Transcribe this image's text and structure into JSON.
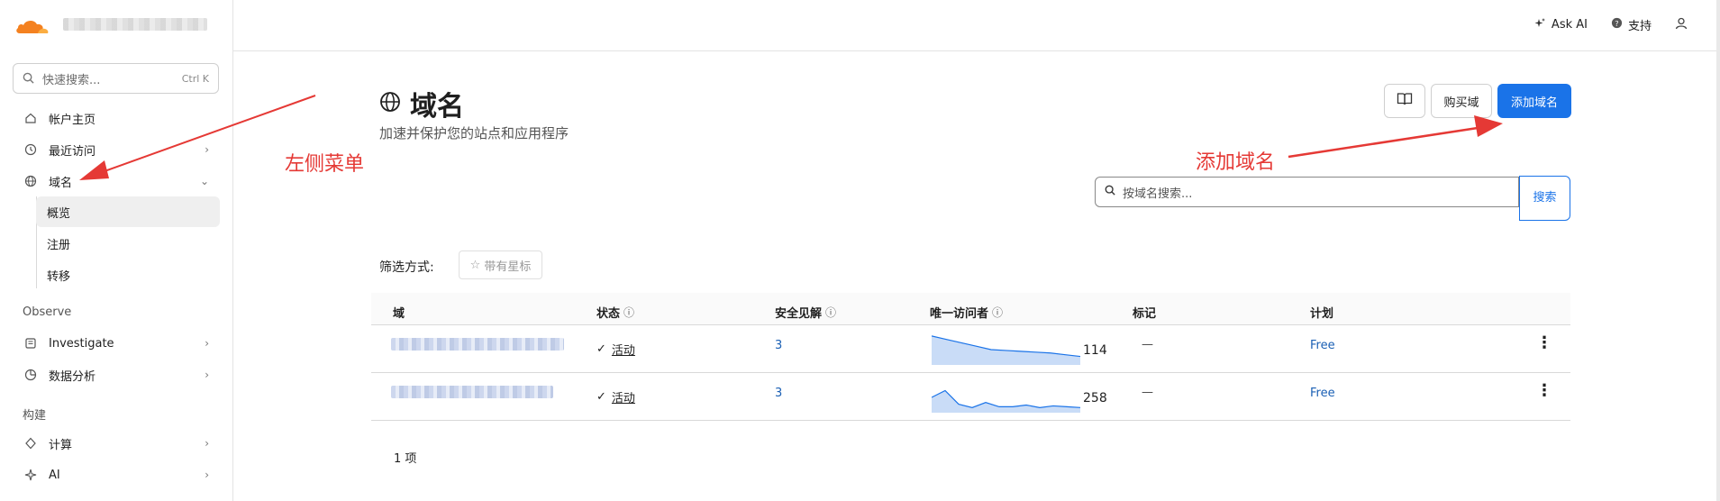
{
  "colors": {
    "accent": "#1a73e8",
    "brand": "#f48120",
    "annotation": "#e53935",
    "link": "#1a5fb4"
  },
  "sidebar": {
    "search": {
      "placeholder": "快速搜索...",
      "shortcut": "Ctrl K"
    },
    "items": [
      {
        "label": "帐户主页",
        "icon": "home-icon"
      },
      {
        "label": "最近访问",
        "icon": "history-icon"
      },
      {
        "label": "域名",
        "icon": "globe-icon"
      }
    ],
    "sub_items": [
      {
        "label": "概览"
      },
      {
        "label": "注册"
      },
      {
        "label": "转移"
      }
    ],
    "sections": [
      {
        "title": "Observe",
        "items": [
          {
            "label": "Investigate",
            "icon": "investigate-icon"
          },
          {
            "label": "数据分析",
            "icon": "analytics-icon"
          }
        ]
      },
      {
        "title": "构建",
        "items": [
          {
            "label": "计算",
            "icon": "compute-icon"
          },
          {
            "label": "AI",
            "icon": "sparkle-icon"
          }
        ]
      }
    ]
  },
  "topbar": {
    "ask_ai": "Ask AI",
    "support": "支持"
  },
  "page": {
    "title": "域名",
    "subtitle": "加速并保护您的站点和应用程序",
    "buy_domain": "购买域",
    "add_domain": "添加域名",
    "search_placeholder": "按域名搜索...",
    "search_button": "搜索",
    "filter_label": "筛选方式:",
    "filter_starred": "带有星标"
  },
  "table": {
    "headers": {
      "domain": "域",
      "status": "状态",
      "insights": "安全见解",
      "visitors": "唯一访问者",
      "tags": "标记",
      "plan": "计划"
    },
    "rows": [
      {
        "status": "活动",
        "insights": "3",
        "visitors": "114",
        "tags": "—",
        "plan": "Free",
        "sparkline": [
          34,
          30,
          26,
          22,
          18,
          17,
          16,
          15,
          14,
          12,
          10
        ]
      },
      {
        "status": "活动",
        "insights": "3",
        "visitors": "258",
        "tags": "—",
        "plan": "Free",
        "sparkline": [
          18,
          26,
          10,
          6,
          12,
          7,
          7,
          9,
          6,
          8,
          7,
          6
        ]
      }
    ],
    "count": "1 项"
  },
  "annotations": {
    "left_menu": "左侧菜单",
    "add_domain": "添加域名"
  }
}
